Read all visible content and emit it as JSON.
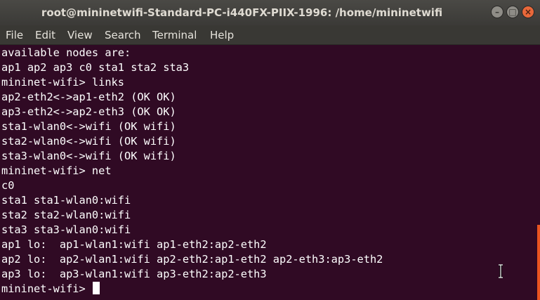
{
  "window": {
    "title": "root@mininetwifi-Standard-PC-i440FX-PIIX-1996: /home/mininetwifi",
    "buttons": {
      "minimize": "–",
      "maximize": "□",
      "close": "×"
    }
  },
  "menu": [
    "File",
    "Edit",
    "View",
    "Search",
    "Terminal",
    "Help"
  ],
  "terminal": {
    "lines": [
      "available nodes are:",
      "ap1 ap2 ap3 c0 sta1 sta2 sta3",
      "mininet-wifi> links",
      "ap2-eth2<->ap1-eth2 (OK OK)",
      "ap3-eth2<->ap2-eth3 (OK OK)",
      "sta1-wlan0<->wifi (OK wifi)",
      "sta2-wlan0<->wifi (OK wifi)",
      "sta3-wlan0<->wifi (OK wifi)",
      "mininet-wifi> net",
      "c0",
      "sta1 sta1-wlan0:wifi",
      "sta2 sta2-wlan0:wifi",
      "sta3 sta3-wlan0:wifi",
      "ap1 lo:  ap1-wlan1:wifi ap1-eth2:ap2-eth2",
      "ap2 lo:  ap2-wlan1:wifi ap2-eth2:ap1-eth2 ap2-eth3:ap3-eth2",
      "ap3 lo:  ap3-wlan1:wifi ap3-eth2:ap2-eth3"
    ],
    "prompt": "mininet-wifi> "
  },
  "colors": {
    "background": "#300a24",
    "text": "#ffffff",
    "scrollbar": "#e95420",
    "close_button": "#e9683a"
  }
}
